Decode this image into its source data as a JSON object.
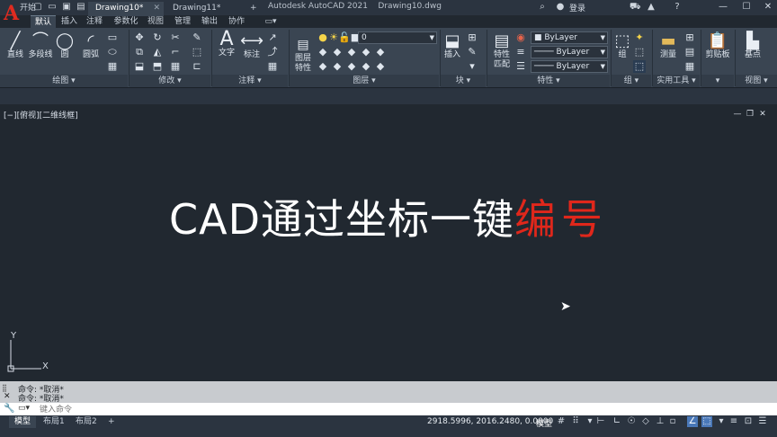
{
  "title": {
    "app": "Autodesk AutoCAD 2021",
    "file": "Drawing10.dwg",
    "login": "登录",
    "logo": "A"
  },
  "ribbon_tabs": [
    "默认",
    "插入",
    "注释",
    "参数化",
    "视图",
    "管理",
    "输出",
    "协作"
  ],
  "ribbon": {
    "draw": {
      "line": "直线",
      "polyline": "多段线",
      "circle": "圆",
      "arc": "圆弧",
      "footer": "绘图"
    },
    "modify": {
      "footer": "修改"
    },
    "annotation": {
      "text": "文字",
      "dimension": "标注",
      "footer": "注释"
    },
    "layers": {
      "properties": "图层\n特性",
      "layer_value": "0",
      "footer": "图层"
    },
    "block": {
      "insert": "插入",
      "footer": "块"
    },
    "properties": {
      "match": "特性\n匹配",
      "color": "ByLayer",
      "linetype": "ByLayer",
      "lineweight": "ByLayer",
      "footer": "特性"
    },
    "groups": {
      "group": "组",
      "footer": "组"
    },
    "utilities": {
      "measure": "测量",
      "footer": "实用工具"
    },
    "clipboard": {
      "paste": "剪贴板",
      "footer": ""
    },
    "view": {
      "base": "基点",
      "footer": "视图"
    }
  },
  "doc_tabs": [
    "开始",
    "Drawing10*",
    "Drawing11*"
  ],
  "viewport": {
    "label": "[−][俯视][二维线框]"
  },
  "headline": {
    "white": "CAD通过坐标一键",
    "red": "编号"
  },
  "ucs": {
    "x": "X",
    "y": "Y"
  },
  "command": {
    "history": [
      "命令: *取消*",
      "命令: *取消*"
    ],
    "placeholder": "键入命令"
  },
  "status": {
    "layout_tabs": [
      "模型",
      "布局1",
      "布局2"
    ],
    "coords": "2918.5996, 2016.2480, 0.0000",
    "model_label": "模型"
  },
  "colors": {
    "accent_red": "#e0271b",
    "canvas": "#212830",
    "ribbon": "#3a4552"
  }
}
